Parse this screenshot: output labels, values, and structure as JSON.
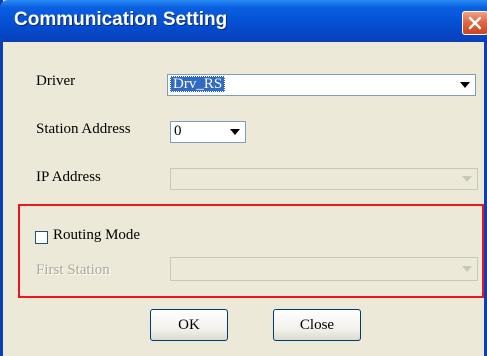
{
  "window": {
    "title": "Communication Setting"
  },
  "driver": {
    "label": "Driver",
    "value": "Drv_RS"
  },
  "station_address": {
    "label": "Station Address",
    "value": "0"
  },
  "ip_address": {
    "label": "IP Address",
    "value": ""
  },
  "routing": {
    "label": "Routing Mode",
    "checked": false,
    "first_station_label": "First Station",
    "first_station_value": ""
  },
  "buttons": {
    "ok": "OK",
    "close": "Close"
  },
  "colors": {
    "titlebar": "#0651d6",
    "dialog_bg": "#ece9d8",
    "highlight_box": "#e8191d",
    "selection": "#316ac5",
    "close_button": "#e06a45"
  },
  "icons": {
    "close": "close-icon",
    "dropdown": "chevron-down-icon"
  }
}
